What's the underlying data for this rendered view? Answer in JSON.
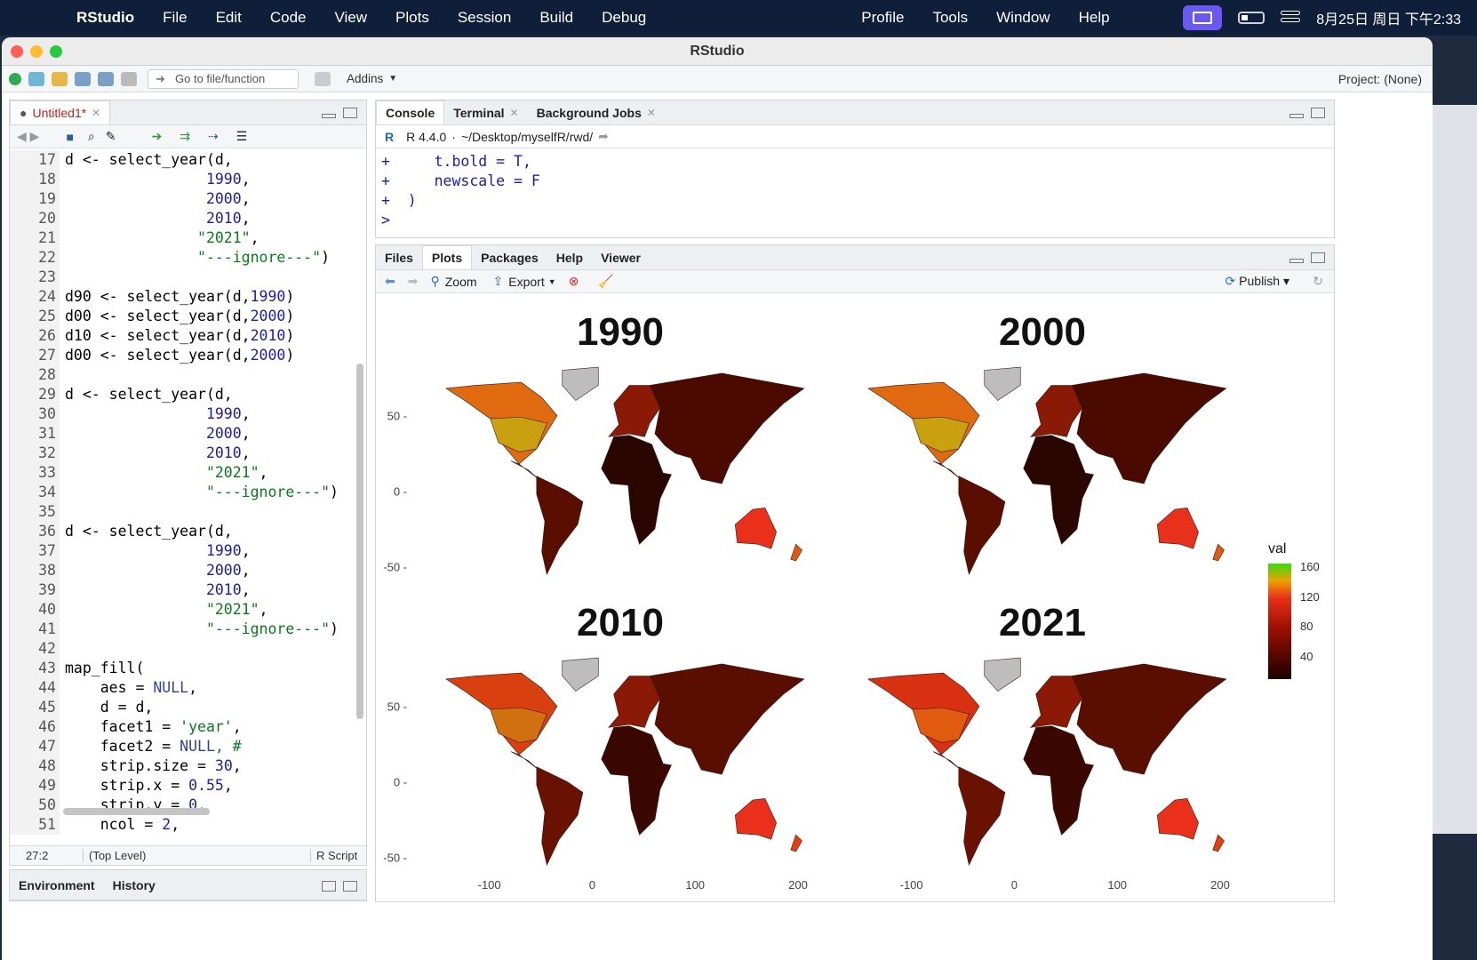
{
  "menubar": {
    "app": "RStudio",
    "items": [
      "File",
      "Edit",
      "Code",
      "View",
      "Plots",
      "Session",
      "Build",
      "Debug",
      "Profile",
      "Tools",
      "Window",
      "Help"
    ],
    "datetime": "8月25日 周日 下午2:33"
  },
  "window": {
    "title": "RStudio"
  },
  "toolbar": {
    "goto_placeholder": "Go to file/function",
    "addins": "Addins",
    "project": "Project: (None)"
  },
  "editor": {
    "tab": "Untitled1*",
    "first_line": 17,
    "lines": [
      [
        [
          "d <- select_year(d,",
          "t"
        ]
      ],
      [
        [
          "                1990",
          "n"
        ],
        [
          ",",
          "t"
        ]
      ],
      [
        [
          "                2000",
          "n"
        ],
        [
          ",",
          "t"
        ]
      ],
      [
        [
          "                2010",
          "n"
        ],
        [
          ",",
          "t"
        ]
      ],
      [
        [
          "               \"2021\"",
          "s"
        ],
        [
          ",",
          "t"
        ]
      ],
      [
        [
          "               \"---ignore---\"",
          "s"
        ],
        [
          ")",
          "t"
        ]
      ],
      [
        [
          "",
          "t"
        ]
      ],
      [
        [
          "d90 <- select_year(d,",
          "t"
        ],
        [
          "1990",
          "n"
        ],
        [
          ")",
          "t"
        ]
      ],
      [
        [
          "d00 <- select_year(d,",
          "t"
        ],
        [
          "2000",
          "n"
        ],
        [
          ")",
          "t"
        ]
      ],
      [
        [
          "d10 <- select_year(d,",
          "t"
        ],
        [
          "2010",
          "n"
        ],
        [
          ")",
          "t"
        ]
      ],
      [
        [
          "d00 <- select_year(d,",
          "t"
        ],
        [
          "2000",
          "n"
        ],
        [
          ")",
          "t"
        ]
      ],
      [
        [
          "",
          "t"
        ]
      ],
      [
        [
          "d <- select_year(d,",
          "t"
        ]
      ],
      [
        [
          "                1990",
          "n"
        ],
        [
          ",",
          "t"
        ]
      ],
      [
        [
          "                2000",
          "n"
        ],
        [
          ",",
          "t"
        ]
      ],
      [
        [
          "                2010",
          "n"
        ],
        [
          ",",
          "t"
        ]
      ],
      [
        [
          "                \"2021\"",
          "s"
        ],
        [
          ",",
          "t"
        ]
      ],
      [
        [
          "                \"---ignore---\"",
          "s"
        ],
        [
          ")",
          "t"
        ]
      ],
      [
        [
          "",
          "t"
        ]
      ],
      [
        [
          "d <- select_year(d,",
          "t"
        ]
      ],
      [
        [
          "                1990",
          "n"
        ],
        [
          ",",
          "t"
        ]
      ],
      [
        [
          "                2000",
          "n"
        ],
        [
          ",",
          "t"
        ]
      ],
      [
        [
          "                2010",
          "n"
        ],
        [
          ",",
          "t"
        ]
      ],
      [
        [
          "                \"2021\"",
          "s"
        ],
        [
          ",",
          "t"
        ]
      ],
      [
        [
          "                \"---ignore---\"",
          "s"
        ],
        [
          ")",
          "t"
        ]
      ],
      [
        [
          "",
          "t"
        ]
      ],
      [
        [
          "map_fill(",
          "t"
        ]
      ],
      [
        [
          "    aes = ",
          "t"
        ],
        [
          "NULL",
          "k"
        ],
        [
          ",",
          "t"
        ]
      ],
      [
        [
          "    d = d,",
          "t"
        ]
      ],
      [
        [
          "    facet1 = ",
          "t"
        ],
        [
          "'year'",
          "s"
        ],
        [
          ",",
          "t"
        ]
      ],
      [
        [
          "    facet2 = ",
          "t"
        ],
        [
          "NULL",
          "k"
        ],
        [
          ", #",
          "s"
        ]
      ],
      [
        [
          "    strip.size = ",
          "t"
        ],
        [
          "30",
          "n"
        ],
        [
          ",",
          "t"
        ]
      ],
      [
        [
          "    strip.x = ",
          "t"
        ],
        [
          "0.55",
          "n"
        ],
        [
          ",",
          "t"
        ]
      ],
      [
        [
          "    strip.y = ",
          "t"
        ],
        [
          "0",
          "n"
        ],
        [
          ",",
          "t"
        ]
      ],
      [
        [
          "    ncol = ",
          "t"
        ],
        [
          "2",
          "n"
        ],
        [
          ",",
          "t"
        ]
      ],
      [
        [
          "",
          "t"
        ]
      ]
    ],
    "status": {
      "position": "27:2",
      "scope": "(Top Level)",
      "type": "R Script"
    }
  },
  "env_pane": {
    "tabs": [
      "Environment",
      "History"
    ]
  },
  "console": {
    "tabs": [
      "Console",
      "Terminal",
      "Background Jobs"
    ],
    "version": "R 4.4.0",
    "path": "~/Desktop/myselfR/rwd/",
    "lines": [
      {
        "prompt": "+",
        "text": "    t.bold = T,"
      },
      {
        "prompt": "+",
        "text": "    newscale = F"
      },
      {
        "prompt": "+",
        "text": " )"
      },
      {
        "prompt": ">",
        "text": ""
      }
    ]
  },
  "plots_pane": {
    "tabs": [
      "Files",
      "Plots",
      "Packages",
      "Help",
      "Viewer"
    ],
    "zoom": "Zoom",
    "export": "Export",
    "publish": "Publish"
  },
  "chart_data": {
    "type": "heatmap",
    "facets": [
      "1990",
      "2000",
      "2010",
      "2021"
    ],
    "legend_title": "val",
    "legend_ticks": [
      40,
      80,
      120,
      160
    ],
    "x_ticks": [
      -100,
      0,
      100,
      200
    ],
    "y_ticks": [
      50,
      0,
      -50
    ],
    "colors": {
      "low": "#1a0000",
      "mid": "#e8301a",
      "high": "#33dd11",
      "na": "#bfbfbf"
    }
  },
  "dock": {
    "calendar_day": "25"
  }
}
